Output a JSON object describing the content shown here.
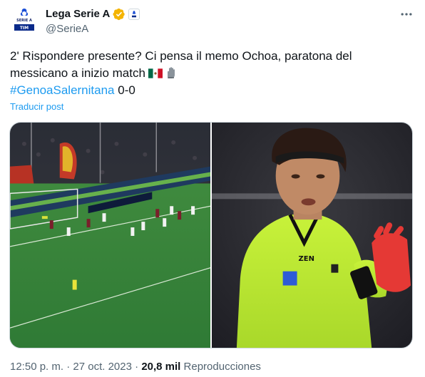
{
  "author": {
    "display_name": "Lega Serie A",
    "handle": "@SerieA",
    "avatar_text_top": "SERIE A",
    "avatar_text_bottom": "TIM",
    "verified_icon": "verified-gold-icon",
    "affiliate_icon": "serie-a-affiliate-icon"
  },
  "tweet": {
    "line1": "2' Rispondere presente? Ci pensa il memo Ochoa, paratona del",
    "line2": "messicano a inizio match",
    "hashtag": "#GenoaSalernitana",
    "score": " 0-0",
    "emoji": [
      "mexico-flag-emoji",
      "gloves-emoji"
    ]
  },
  "translate_label": "Traducir post",
  "media": [
    {
      "name": "stadium-match-photo"
    },
    {
      "name": "ochoa-goalkeeper-photo",
      "ad_text": "ZEN"
    }
  ],
  "meta": {
    "time": "12:50 p. m.",
    "separator": " · ",
    "date": "27 oct. 2023",
    "views_count": "20,8 mil",
    "views_label": " Reproducciones"
  },
  "colors": {
    "accent": "#1d9bf0",
    "text": "#0f1419",
    "secondary": "#536471",
    "verified": "#f4b400"
  }
}
